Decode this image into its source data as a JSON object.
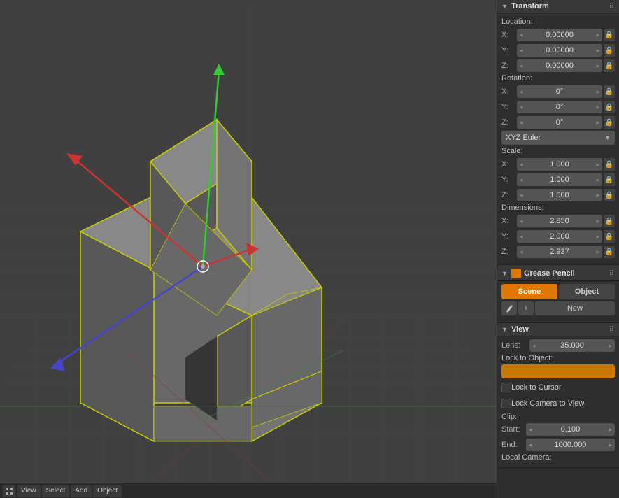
{
  "transform": {
    "title": "Transform",
    "location": {
      "label": "Location:",
      "x": {
        "label": "X:",
        "value": "0.00000"
      },
      "y": {
        "label": "Y:",
        "value": "0.00000"
      },
      "z": {
        "label": "Z:",
        "value": "0.00000"
      }
    },
    "rotation": {
      "label": "Rotation:",
      "x": {
        "label": "X:",
        "value": "0°"
      },
      "y": {
        "label": "Y:",
        "value": "0°"
      },
      "z": {
        "label": "Z:",
        "value": "0°"
      },
      "mode": "XYZ Euler"
    },
    "scale": {
      "label": "Scale:",
      "x": {
        "label": "X:",
        "value": "1.000"
      },
      "y": {
        "label": "Y:",
        "value": "1.000"
      },
      "z": {
        "label": "Z:",
        "value": "1.000"
      }
    },
    "dimensions": {
      "label": "Dimensions:",
      "x": {
        "label": "X:",
        "value": "2.850"
      },
      "y": {
        "label": "Y:",
        "value": "2.000"
      },
      "z": {
        "label": "Z:",
        "value": "2.937"
      }
    }
  },
  "grease_pencil": {
    "title": "Grease Pencil",
    "scene_btn": "Scene",
    "object_btn": "Object",
    "new_btn": "New"
  },
  "view": {
    "title": "View",
    "lens_label": "Lens:",
    "lens_value": "35.000",
    "lock_object_label": "Lock to Object:",
    "lock_cursor_label": "Lock to Cursor",
    "lock_camera_label": "Lock Camera to View",
    "clip_label": "Clip:",
    "start_label": "Start:",
    "start_value": "0.100",
    "end_label": "End:",
    "end_value": "1000.000",
    "local_camera_label": "Local Camera:"
  },
  "bottom_bar": {
    "view_label": "View",
    "select_label": "Select",
    "add_label": "Add",
    "object_label": "Object"
  },
  "colors": {
    "orange_accent": "#e07800",
    "axis_x": "#cc3333",
    "axis_y": "#33cc33",
    "axis_z": "#3333cc",
    "grid": "#555555",
    "object_selected": "#cccc00"
  }
}
